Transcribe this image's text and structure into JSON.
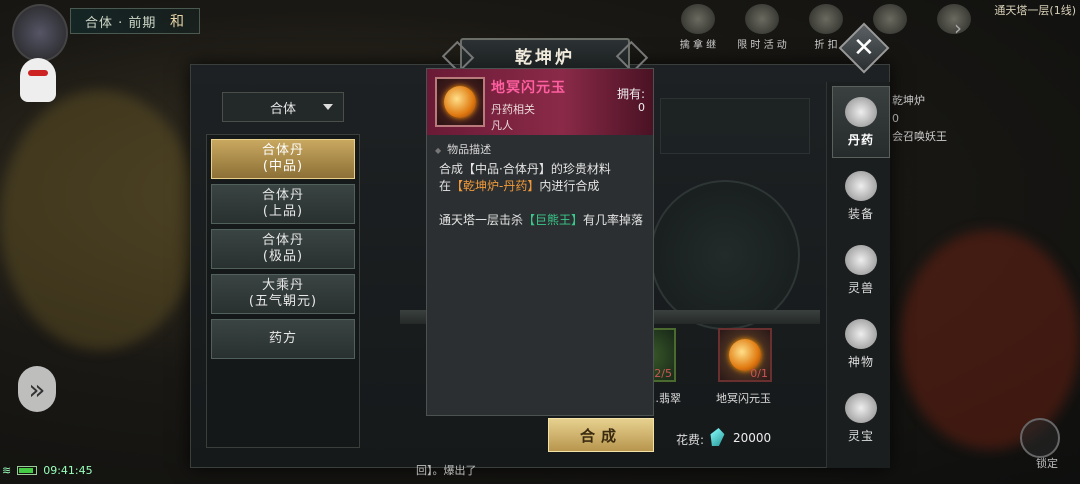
{
  "hud": {
    "realm_label": "合体 · 前期",
    "realm_extra": "和",
    "top_icons": [
      "擒 拿 继",
      "限 时 活 动",
      "折 扣",
      "",
      ""
    ],
    "top_right_label": "通天塔一层(1线)",
    "clock": "09:41:45",
    "lock_label": "锁定",
    "right_bg": {
      "furnace": "乾坤炉",
      "value": "0",
      "summon": "会召唤妖王"
    }
  },
  "panel": {
    "title": "乾坤炉",
    "close_label": "✕",
    "realm_select": "合体",
    "recipes": [
      {
        "line1": "合体丹",
        "line2": "(中品)",
        "active": true
      },
      {
        "line1": "合体丹",
        "line2": "(上品)",
        "active": false
      },
      {
        "line1": "合体丹",
        "line2": "(极品)",
        "active": false
      },
      {
        "line1": "大乘丹",
        "line2": "(五气朝元)",
        "active": false
      },
      {
        "line1": "药方",
        "line2": "",
        "active": false
      }
    ],
    "materials": [
      {
        "name": "…翡翠",
        "count": "2/5"
      },
      {
        "name": "地冥闪元玉",
        "count": "0/1"
      }
    ],
    "craft_button": "合成",
    "cost_label": "花费:",
    "cost_value": "20000",
    "bottom_text": "回】。爆出了"
  },
  "tabs": [
    {
      "label": "丹药",
      "icon": "pill-bowl-icon",
      "active": true
    },
    {
      "label": "装备",
      "icon": "sword-icon",
      "active": false
    },
    {
      "label": "灵兽",
      "icon": "paw-icon",
      "active": false
    },
    {
      "label": "神物",
      "icon": "fan-icon",
      "active": false
    },
    {
      "label": "灵宝",
      "icon": "spirit-treasure-icon",
      "active": false
    }
  ],
  "tooltip": {
    "name": "地冥闪元玉",
    "type": "丹药相关",
    "grade": "凡人",
    "own_label": "拥有:",
    "own_value": "0",
    "section": "物品描述",
    "desc1_a": "合成【中品·合体丹】的珍贵材料",
    "desc2_a": "在",
    "desc2_hl": "【乾坤炉-丹药】",
    "desc2_b": "内进行合成",
    "desc3_a": "通天塔一层击杀",
    "desc3_hl": "【巨熊王】",
    "desc3_b": "有几率掉落"
  },
  "colors": {
    "accent_gold": "#c9a860",
    "tooltip_head": "#8a2a48",
    "name_pink": "#ff5fa0",
    "hl_orange": "#f09a3a",
    "hl_green": "#3ac88a"
  }
}
